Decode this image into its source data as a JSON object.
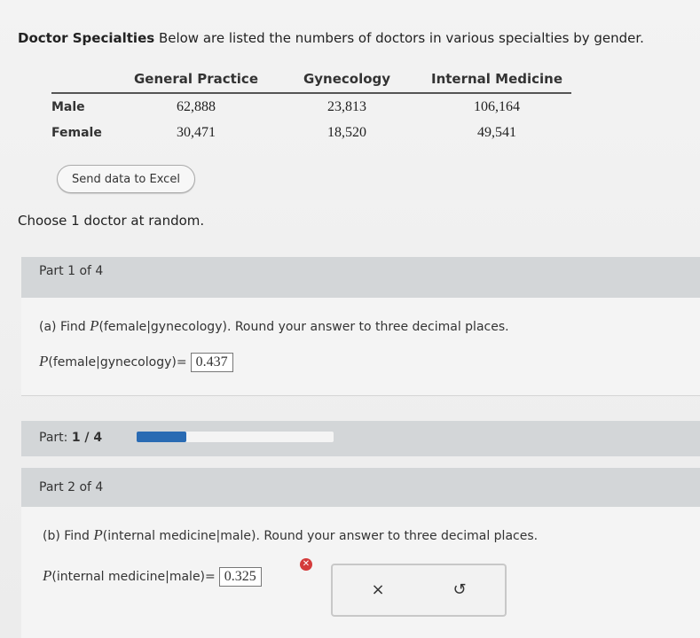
{
  "intro": {
    "title": "Doctor Specialties",
    "text": " Below are listed the numbers of doctors in various specialties by gender."
  },
  "table": {
    "headers": [
      "",
      "General Practice",
      "Gynecology",
      "Internal Medicine"
    ],
    "rows": [
      {
        "label": "Male",
        "values": [
          "62,888",
          "23,813",
          "106,164"
        ]
      },
      {
        "label": "Female",
        "values": [
          "30,471",
          "18,520",
          "49,541"
        ]
      }
    ]
  },
  "excel_button": "Send data to Excel",
  "choose_text": "Choose 1 doctor at random.",
  "part1": {
    "header": "Part 1 of 4",
    "question_prefix": "(a) Find ",
    "P": "P",
    "question_expr": "(female|gynecology)",
    "question_suffix": ". Round your answer to three decimal places.",
    "answer_expr": "(female|gynecology)",
    "equals": "=",
    "answer": "0.437"
  },
  "progress": {
    "label": "Part: ",
    "value_text": "1 / 4",
    "fraction": 0.25,
    "color": "#2a6bb3"
  },
  "part2": {
    "header": "Part 2 of 4",
    "question_prefix": "(b) Find ",
    "P": "P",
    "question_expr": "(internal medicine|male)",
    "question_suffix": ". Round your answer to three decimal places.",
    "answer_expr": "(internal medicine|male)",
    "equals": "=",
    "answer": "0.325",
    "error_color": "#d43b3b"
  },
  "icons": {
    "error": "x-badge-icon",
    "clear": "close-icon",
    "undo": "undo-icon"
  },
  "glyphs": {
    "error": "✕",
    "clear": "×",
    "undo": "↺"
  }
}
